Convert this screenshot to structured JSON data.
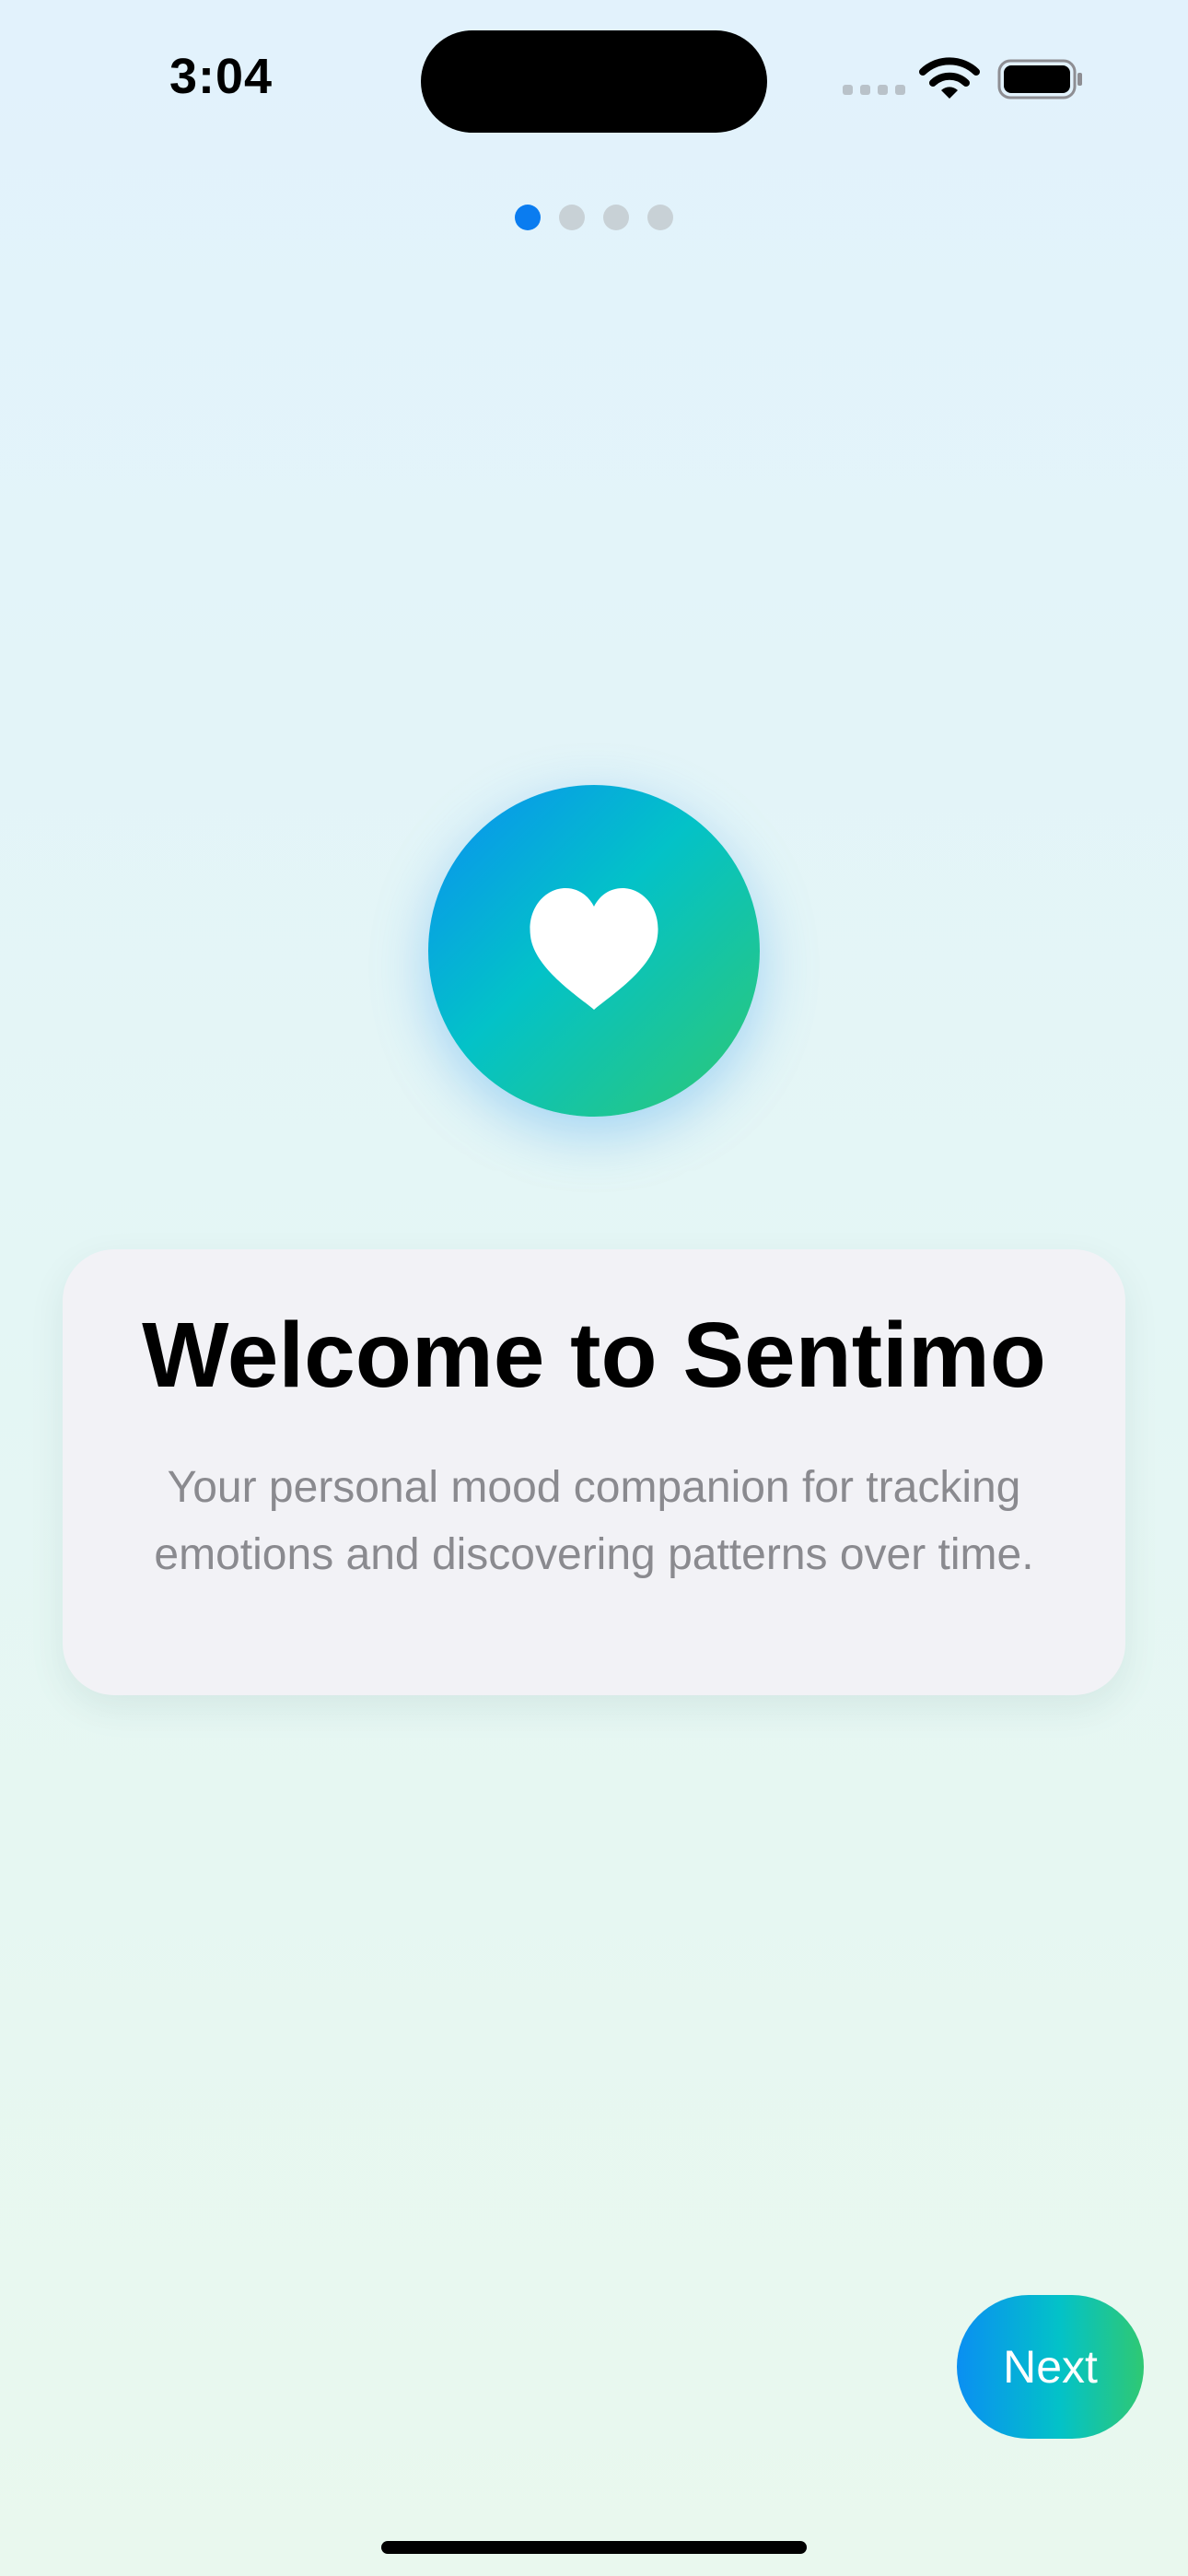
{
  "status_bar": {
    "time": "3:04",
    "icons": [
      "cellular-signal-icon",
      "wifi-icon",
      "battery-icon"
    ]
  },
  "onboarding": {
    "page_count": 4,
    "current_page": 1
  },
  "hero": {
    "icon": "heart-icon"
  },
  "card": {
    "title": "Welcome to Sentimo",
    "description": "Your personal mood companion for tracking emotions and discovering patterns over time."
  },
  "actions": {
    "next_label": "Next"
  },
  "colors": {
    "accent_blue": "#0a7cf0",
    "gradient_start": "#0a8ff2",
    "gradient_mid": "#03c2c8",
    "gradient_end": "#2fc873",
    "card_background": "#f2f2f6",
    "description_text": "#8a8a8f"
  }
}
